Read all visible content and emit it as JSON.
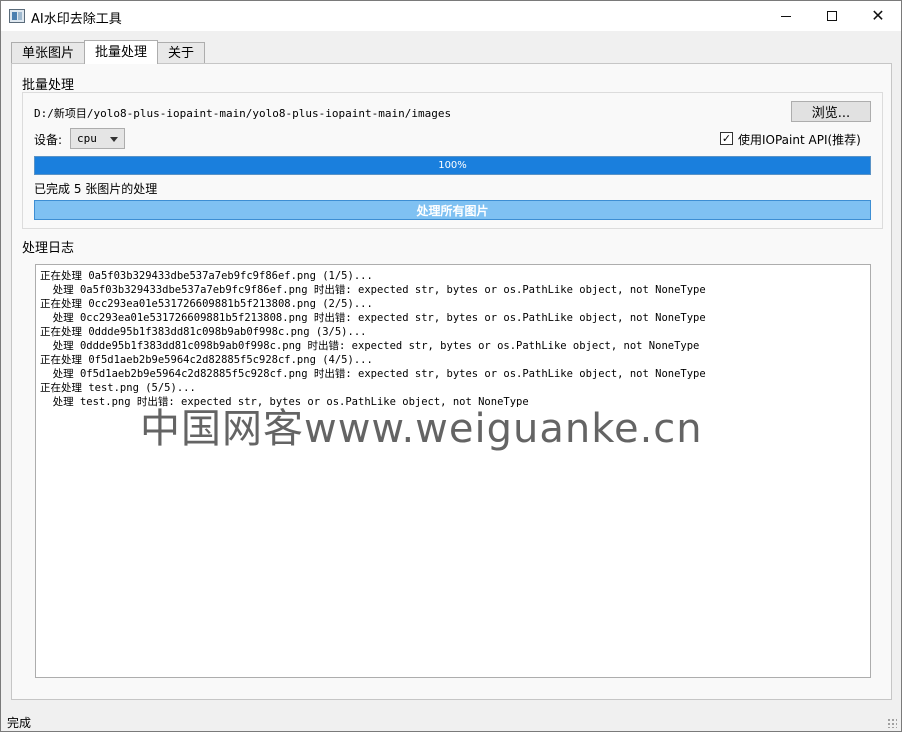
{
  "window": {
    "title": "AI水印去除工具",
    "controls": {
      "minimize": "minimize-icon",
      "maximize": "maximize-icon",
      "close": "close-icon"
    }
  },
  "tabs": [
    {
      "label": "单张图片",
      "active": false
    },
    {
      "label": "批量处理",
      "active": true
    },
    {
      "label": "关于",
      "active": false
    }
  ],
  "batch": {
    "group_title": "批量处理",
    "path": "D:/新项目/yolo8-plus-iopaint-main/yolo8-plus-iopaint-main/images",
    "browse_label": "浏览...",
    "device_label": "设备:",
    "device_value": "cpu",
    "use_iopaint_label": "使用IOPaint API(推荐)",
    "use_iopaint_checked": true,
    "progress_percent": 100,
    "progress_text": "100%",
    "status_text": "已完成 5 张图片的处理",
    "process_label": "处理所有图片",
    "accent_color": "#1a7fdd"
  },
  "log": {
    "title": "处理日志",
    "lines": [
      "正在处理 0a5f03b329433dbe537a7eb9fc9f86ef.png (1/5)...",
      "  处理 0a5f03b329433dbe537a7eb9fc9f86ef.png 时出错: expected str, bytes or os.PathLike object, not NoneType",
      "正在处理 0cc293ea01e531726609881b5f213808.png (2/5)...",
      "  处理 0cc293ea01e531726609881b5f213808.png 时出错: expected str, bytes or os.PathLike object, not NoneType",
      "正在处理 0ddde95b1f383dd81c098b9ab0f998c.png (3/5)...",
      "  处理 0ddde95b1f383dd81c098b9ab0f998c.png 时出错: expected str, bytes or os.PathLike object, not NoneType",
      "正在处理 0f5d1aeb2b9e5964c2d82885f5c928cf.png (4/5)...",
      "  处理 0f5d1aeb2b9e5964c2d82885f5c928cf.png 时出错: expected str, bytes or os.PathLike object, not NoneType",
      "正在处理 test.png (5/5)...",
      "  处理 test.png 时出错: expected str, bytes or os.PathLike object, not NoneType"
    ]
  },
  "watermark": "中国网客www.weiguanke.cn",
  "statusbar": {
    "text": "完成"
  }
}
